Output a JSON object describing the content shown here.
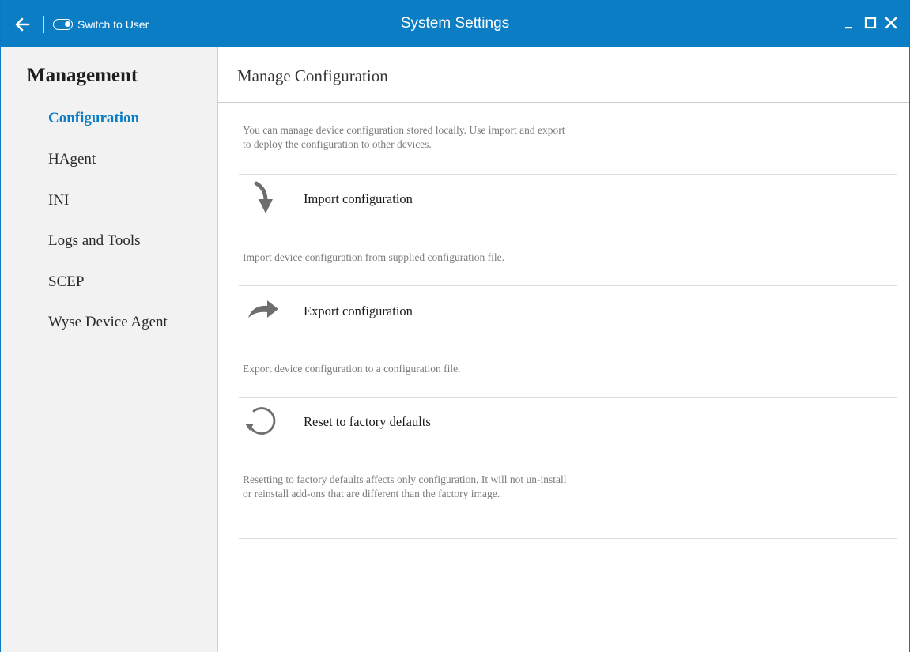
{
  "titlebar": {
    "title": "System Settings",
    "switch_label": "Switch to User",
    "back_icon": "arrow-left-icon",
    "minimize_icon": "minimize-icon",
    "maximize_icon": "maximize-icon",
    "close_icon": "close-icon",
    "accent_color": "#0b7dc4"
  },
  "sidebar": {
    "title": "Management",
    "items": [
      {
        "label": "Configuration",
        "active": true
      },
      {
        "label": "HAgent",
        "active": false
      },
      {
        "label": "INI",
        "active": false
      },
      {
        "label": "Logs and Tools",
        "active": false
      },
      {
        "label": "SCEP",
        "active": false
      },
      {
        "label": "Wyse Device Agent",
        "active": false
      }
    ]
  },
  "main": {
    "title": "Manage Configuration",
    "intro": "You can manage device configuration stored locally. Use import and export to deploy the configuration to other devices.",
    "actions": [
      {
        "label": "Import configuration",
        "icon": "arrow-down-curved-icon",
        "description": "Import device configuration from supplied configuration file."
      },
      {
        "label": "Export configuration",
        "icon": "share-arrow-icon",
        "description": "Export device configuration to a configuration file."
      },
      {
        "label": "Reset to factory defaults",
        "icon": "reset-icon",
        "description": "Resetting to factory defaults affects only configuration, It will not un-install or reinstall add-ons that are different than the factory image."
      }
    ]
  }
}
